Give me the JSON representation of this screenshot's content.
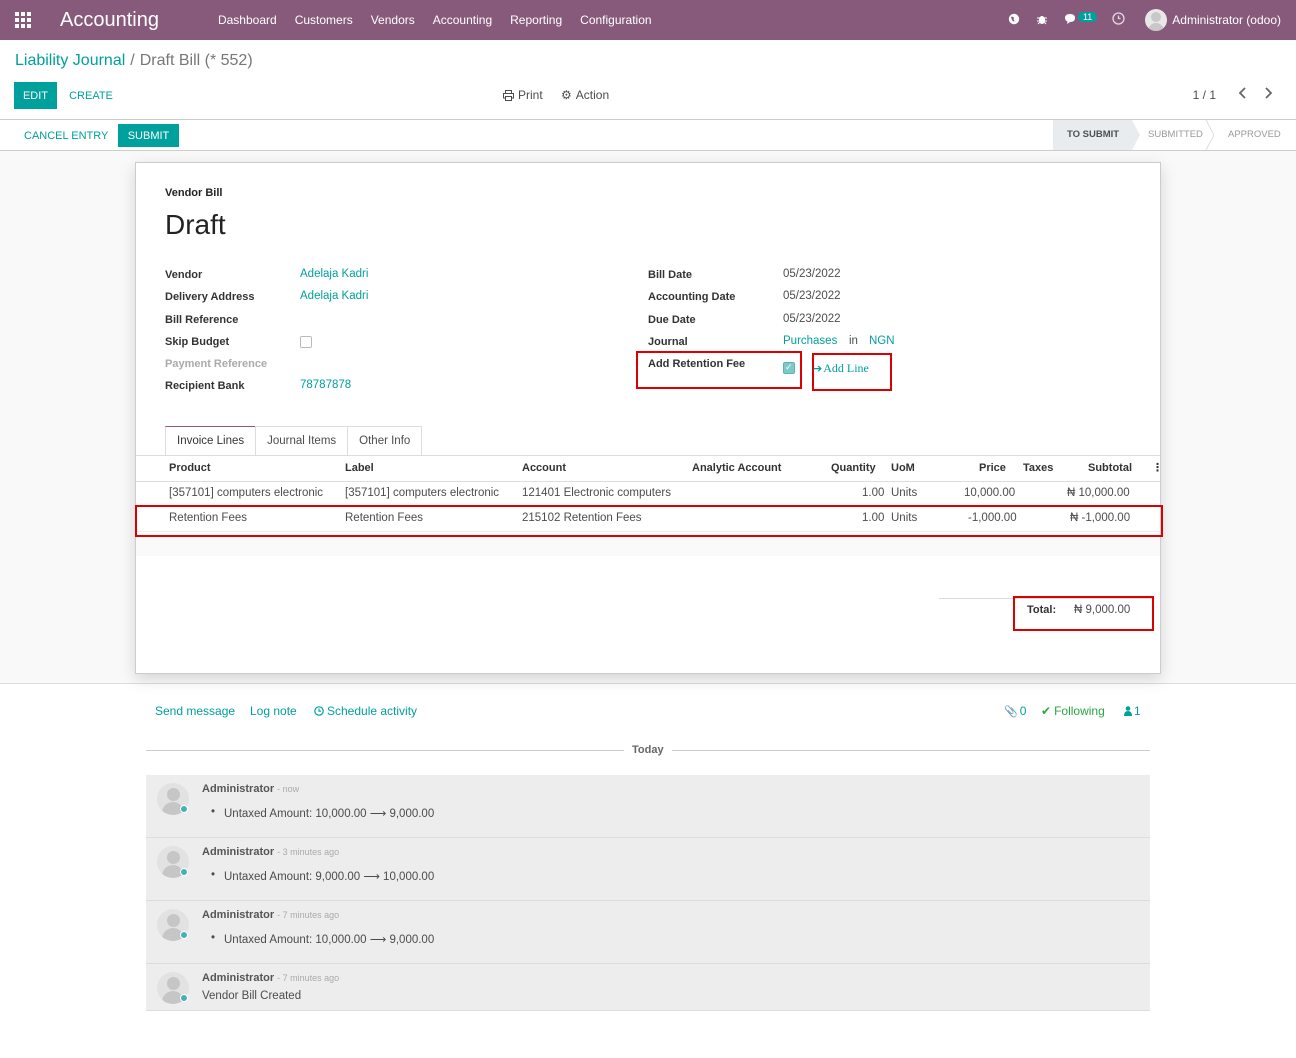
{
  "navbar": {
    "app_name": "Accounting",
    "menu": [
      "Dashboard",
      "Customers",
      "Vendors",
      "Accounting",
      "Reporting",
      "Configuration"
    ],
    "message_count": "11",
    "user": "Administrator (odoo)"
  },
  "breadcrumb": {
    "parent": "Liability Journal",
    "current": "Draft Bill (* 552)"
  },
  "control_panel": {
    "edit": "EDIT",
    "create": "CREATE",
    "print": "Print",
    "action": "Action",
    "pager": "1 / 1"
  },
  "statusbar": {
    "cancel_entry": "CANCEL ENTRY",
    "submit": "SUBMIT",
    "stages": [
      "TO SUBMIT",
      "SUBMITTED",
      "APPROVED"
    ],
    "active_stage": "TO SUBMIT"
  },
  "form": {
    "doc_type": "Vendor Bill",
    "doc_name": "Draft",
    "left_fields": {
      "vendor_label": "Vendor",
      "vendor": "Adelaja Kadri",
      "delivery_label": "Delivery Address",
      "delivery": "Adelaja Kadri",
      "bill_ref_label": "Bill Reference",
      "skip_budget_label": "Skip Budget",
      "payment_ref_label": "Payment Reference",
      "recipient_bank_label": "Recipient Bank",
      "recipient_bank": "78787878"
    },
    "right_fields": {
      "bill_date_label": "Bill Date",
      "bill_date": "05/23/2022",
      "accounting_date_label": "Accounting Date",
      "accounting_date": "05/23/2022",
      "due_date_label": "Due Date",
      "due_date": "05/23/2022",
      "journal_label": "Journal",
      "journal": "Purchases",
      "journal_in": "in",
      "currency": "NGN",
      "retention_label": "Add Retention Fee",
      "retention_checked": true,
      "add_line": "Add Line"
    },
    "tabs": [
      "Invoice Lines",
      "Journal Items",
      "Other Info"
    ],
    "table": {
      "headers": [
        "Product",
        "Label",
        "Account",
        "Analytic Account",
        "Quantity",
        "UoM",
        "Price",
        "Taxes",
        "Subtotal"
      ],
      "rows": [
        [
          "[357101] computers electronic",
          "[357101] computers electronic",
          "121401 Electronic computers",
          "",
          "1.00",
          "Units",
          "10,000.00",
          "",
          "₦ 10,000.00"
        ],
        [
          "Retention Fees",
          "Retention Fees",
          "215102 Retention Fees",
          "",
          "1.00",
          "Units",
          "-1,000.00",
          "",
          "₦ -1,000.00"
        ]
      ]
    },
    "total_label": "Total:",
    "total_value": "₦ 9,000.00"
  },
  "chatter": {
    "send_message": "Send message",
    "log_note": "Log note",
    "schedule_activity": "Schedule activity",
    "attachments": "0",
    "following": "Following",
    "followers": "1",
    "today": "Today",
    "messages": [
      {
        "author": "Administrator",
        "time": "- now",
        "body": "Untaxed Amount: 10,000.00 ⟶ 9,000.00"
      },
      {
        "author": "Administrator",
        "time": "- 3 minutes ago",
        "body": "Untaxed Amount: 9,000.00 ⟶ 10,000.00"
      },
      {
        "author": "Administrator",
        "time": "- 7 minutes ago",
        "body": "Untaxed Amount: 10,000.00 ⟶ 9,000.00"
      },
      {
        "author": "Administrator",
        "time": "- 7 minutes ago",
        "body": "Vendor Bill Created"
      }
    ]
  },
  "colors": {
    "brand": "#875a7b",
    "accent": "#00a09d",
    "highlight": "#dd0000"
  }
}
